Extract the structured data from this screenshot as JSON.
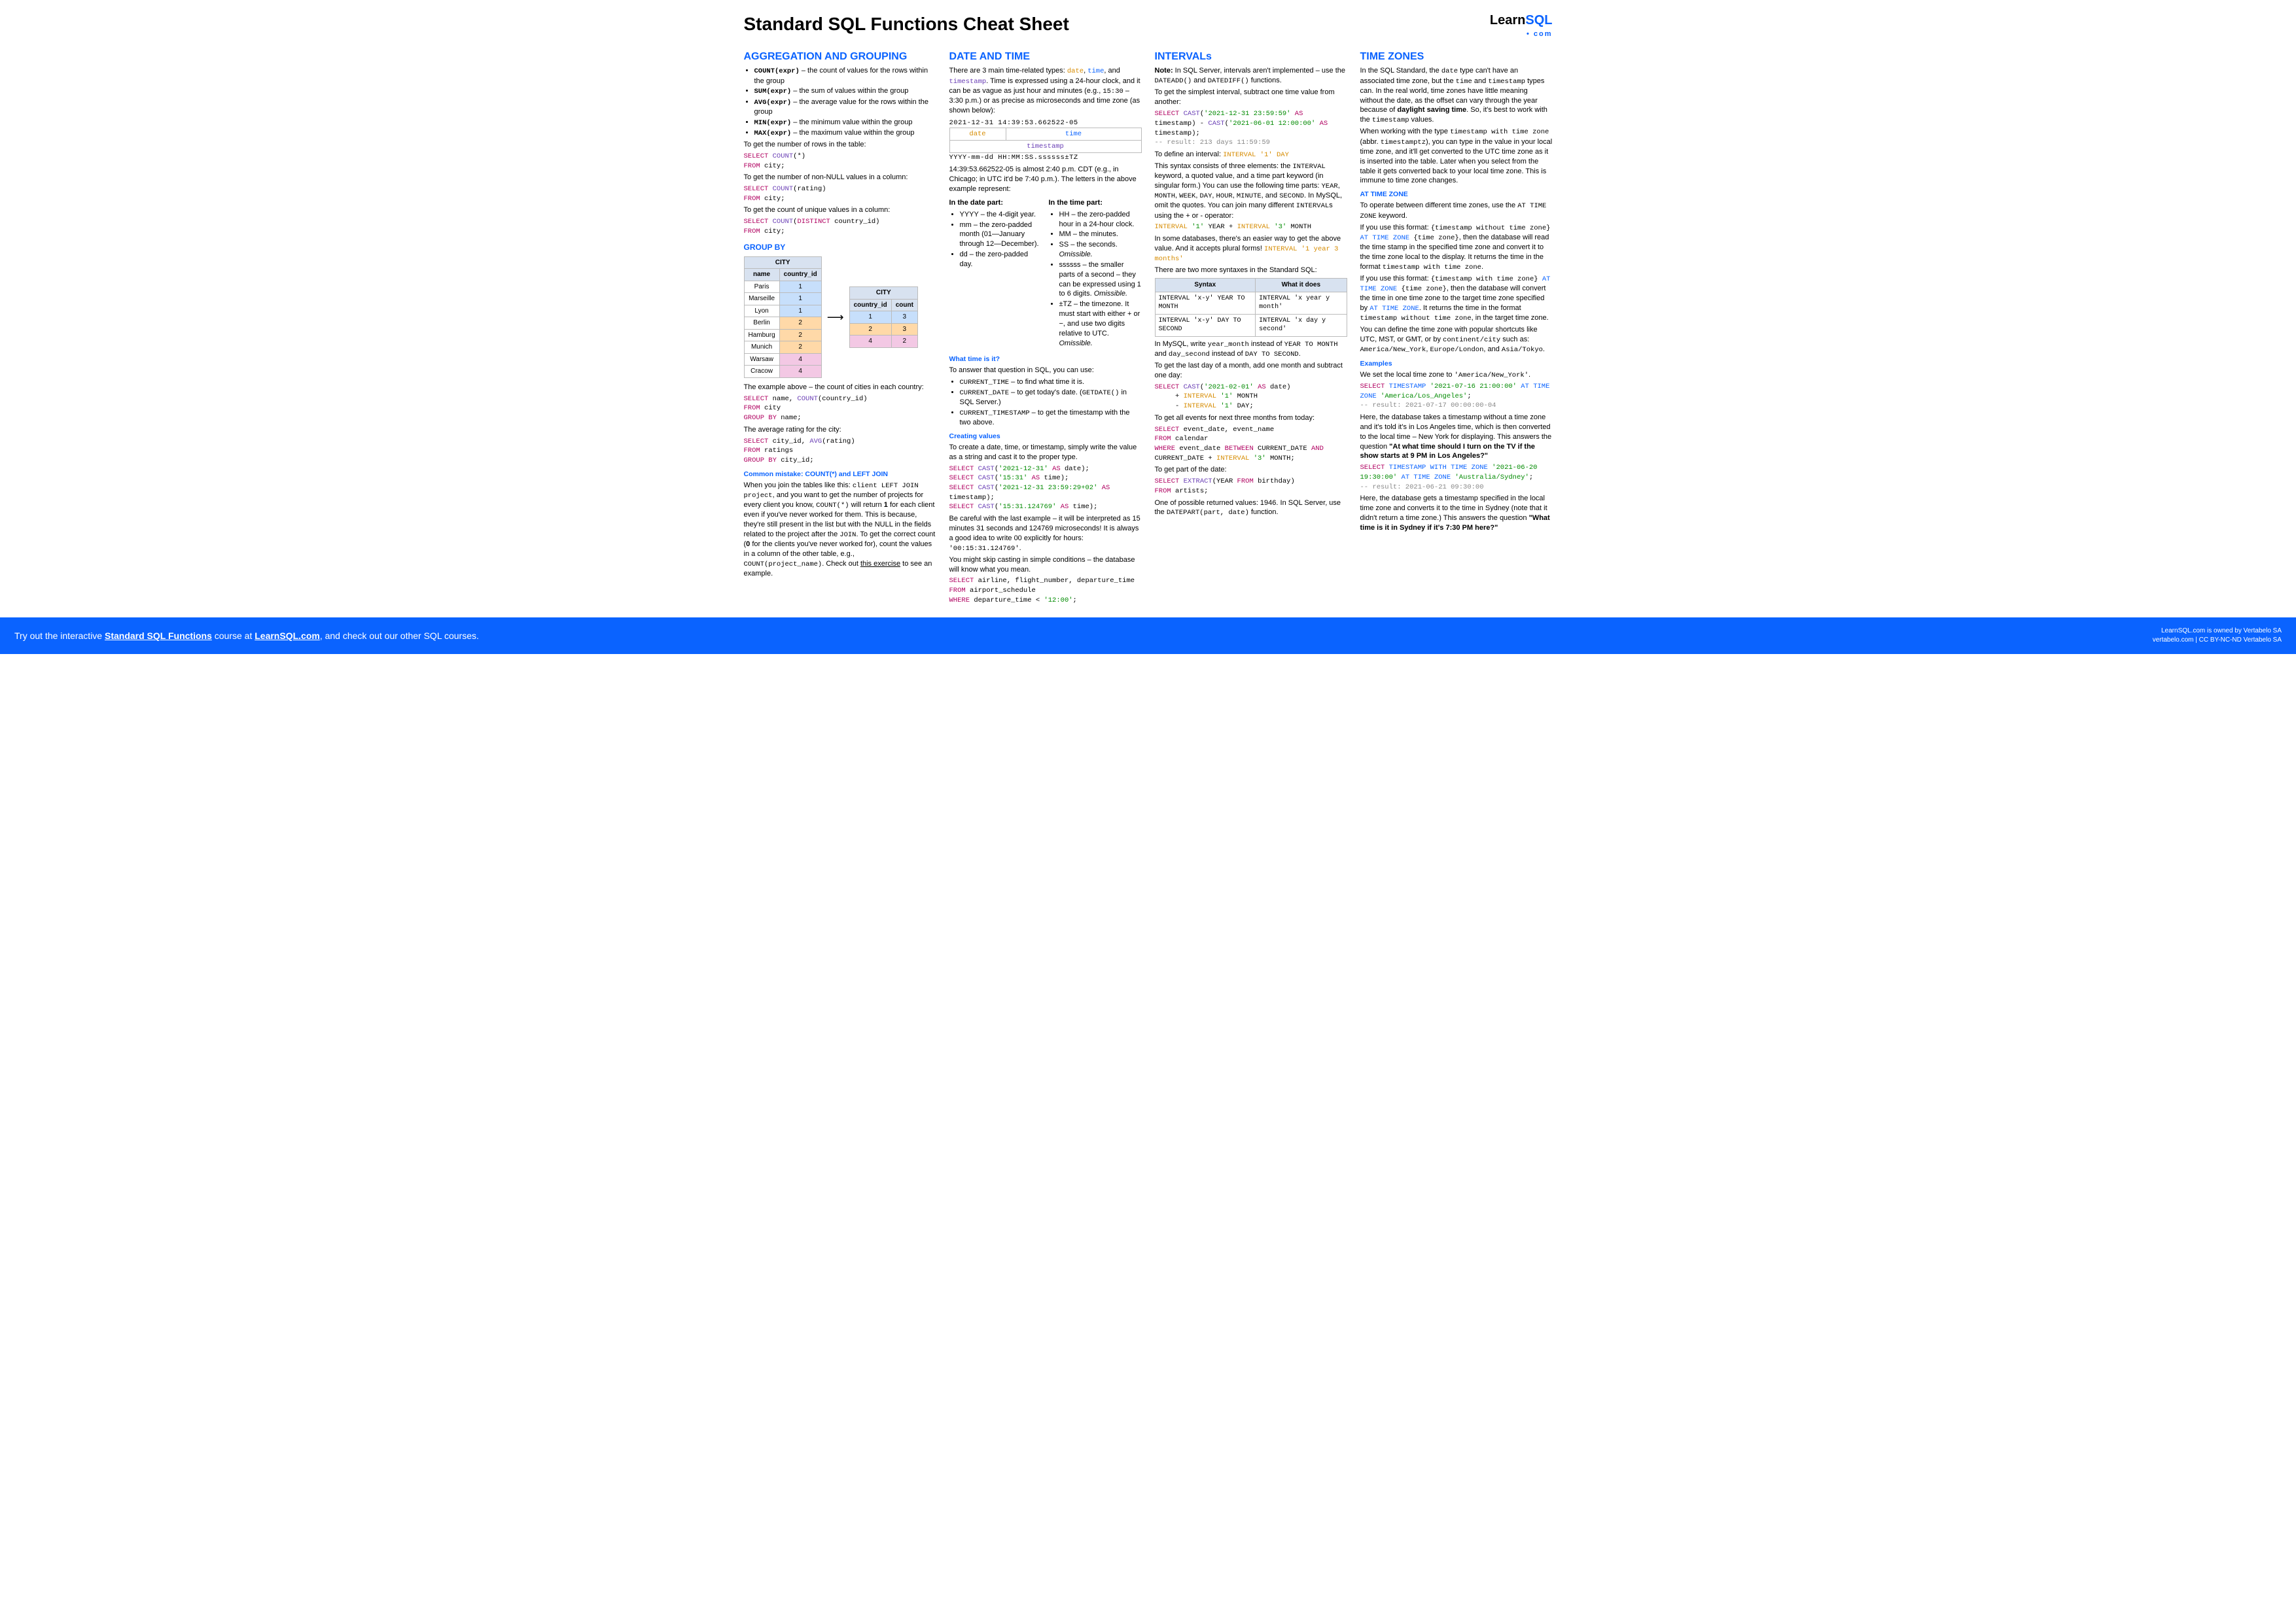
{
  "header": {
    "title": "Standard SQL Functions Cheat Sheet",
    "logo_learn": "Learn",
    "logo_sql": "SQL",
    "logo_com": "• com"
  },
  "col1": {
    "h_agg": "AGGREGATION AND GROUPING",
    "agg_items": [
      {
        "fn": "COUNT(expr)",
        "desc": " – the count of values for the rows within the group"
      },
      {
        "fn": "SUM(expr)",
        "desc": " – the sum of values within the group"
      },
      {
        "fn": "AVG(expr)",
        "desc": " – the average value for the rows within the group"
      },
      {
        "fn": "MIN(expr)",
        "desc": " – the minimum value within the group"
      },
      {
        "fn": "MAX(expr)",
        "desc": " – the maximum value within the group"
      }
    ],
    "p1": "To get the number of rows in the table:",
    "q1": "SELECT COUNT(*)\nFROM city;",
    "p2": "To get the number of non-NULL values in a column:",
    "q2": "SELECT COUNT(rating)\nFROM city;",
    "p3": "To get the count of unique values in a column:",
    "q3": "SELECT COUNT(DISTINCT country_id)\nFROM city;",
    "h_gb": "GROUP BY",
    "city_caption": "CITY",
    "city_cols": [
      "name",
      "country_id"
    ],
    "city_rows": [
      [
        "Paris",
        "1",
        "r-b"
      ],
      [
        "Marseille",
        "1",
        "r-b"
      ],
      [
        "Lyon",
        "1",
        "r-b"
      ],
      [
        "Berlin",
        "2",
        "r-o"
      ],
      [
        "Hamburg",
        "2",
        "r-o"
      ],
      [
        "Munich",
        "2",
        "r-o"
      ],
      [
        "Warsaw",
        "4",
        "r-p"
      ],
      [
        "Cracow",
        "4",
        "r-p"
      ]
    ],
    "city2_caption": "CITY",
    "city2_cols": [
      "country_id",
      "count"
    ],
    "city2_rows": [
      [
        "1",
        "3",
        "r-b"
      ],
      [
        "2",
        "3",
        "r-o"
      ],
      [
        "4",
        "2",
        "r-p"
      ]
    ],
    "gb_p1": "The example above – the count of cities in each country:",
    "gb_q1": "SELECT name, COUNT(country_id)\nFROM city\nGROUP BY name;",
    "gb_p2": "The average rating for the city:",
    "gb_q2": "SELECT city_id, AVG(rating)\nFROM ratings\nGROUP BY city_id;",
    "h_mistake": "Common mistake: COUNT(*) and LEFT JOIN",
    "mistake_text": "When you join the tables like this: client LEFT JOIN project, and you want to get the number of projects for every client you know, COUNT(*) will return 1 for each client even if you've never worked for them. This is because, they're still present in the list but with the NULL in the fields related to the project after the JOIN. To get the correct count (0 for the clients you've never worked for), count the values in a column of the other table, e.g., COUNT(project_name). Check out this exercise to see an example.",
    "mistake_link": "this exercise"
  },
  "col2": {
    "h": "DATE AND TIME",
    "intro": "There are 3 main time-related types: date, time, and timestamp. Time is expressed using a 24-hour clock, and it can be as vague as just hour and minutes (e.g., 15:30 – 3:30 p.m.) or as precise as microseconds and time zone (as shown below):",
    "ts_example": "2021-12-31 14:39:53.662522-05",
    "box_date": "date",
    "box_time": "time",
    "box_ts": "timestamp",
    "ts_format": "YYYY-mm-dd HH:MM:SS.ssssss±TZ",
    "p_explain": "14:39:53.662522-05 is almost 2:40 p.m. CDT (e.g., in Chicago; in UTC it'd be 7:40 p.m.). The letters in the above example represent:",
    "h_datepart": "In the date part:",
    "date_parts": [
      "YYYY – the 4-digit year.",
      "mm – the zero-padded month (01—January through 12—December).",
      "dd – the zero-padded day."
    ],
    "h_timepart": "In the time part:",
    "time_parts_1": "HH – the zero-padded hour in a 24-hour clock.",
    "time_parts_2": "MM – the minutes.",
    "time_parts_3a": "SS – the seconds. ",
    "time_parts_3b": "Omissible.",
    "time_parts_4a": "ssssss – the smaller parts of a second – they can be expressed using 1 to 6 digits. ",
    "time_parts_4b": "Omissible.",
    "time_parts_5a": "±TZ – the timezone. It must start with either + or −, and use two digits relative to UTC. ",
    "time_parts_5b": "Omissible.",
    "h_what": "What time is it?",
    "what_p": "To answer that question in SQL, you can use:",
    "what_items": [
      "CURRENT_TIME – to find what time it is.",
      "CURRENT_DATE – to get today's date. (GETDATE() in SQL Server.)",
      "CURRENT_TIMESTAMP – to get the timestamp with the two above."
    ],
    "h_create": "Creating values",
    "create_p": "To create a date, time, or timestamp, simply write the value as a string and cast it to the proper type.",
    "create_q": "SELECT CAST('2021-12-31' AS date);\nSELECT CAST('15:31' AS time);\nSELECT CAST('2021-12-31 23:59:29+02' AS timestamp);\nSELECT CAST('15:31.124769' AS time);",
    "create_warn": "Be careful with the last example – it will be interpreted as 15 minutes 31 seconds and 124769 microseconds! It is always a good idea to write 00 explicitly for hours: '00:15:31.124769'.",
    "skip_p": "You might skip casting in simple conditions – the database will know what you mean.",
    "skip_q": "SELECT airline, flight_number, departure_time\nFROM airport_schedule\nWHERE departure_time < '12:00';"
  },
  "col3": {
    "h": "INTERVALs",
    "note": "Note: In SQL Server, intervals aren't implemented – use the DATEADD() and DATEDIFF() functions.",
    "p1": "To get the simplest interval, subtract one time value from another:",
    "q1": "SELECT CAST('2021-12-31 23:59:59' AS timestamp) - CAST('2021-06-01 12:00:00' AS timestamp);\n-- result: 213 days 11:59:59",
    "p2a": "To define an interval:  ",
    "p2b": "INTERVAL '1' DAY",
    "p2c": "This syntax consists of three elements: the INTERVAL keyword, a quoted value, and a time part keyword (in singular form.) You can use the following time parts: YEAR, MONTH, WEEK, DAY, HOUR, MINUTE, and SECOND. In MySQL, omit the quotes. You can join many different INTERVALs using the + or - operator:",
    "q2": "INTERVAL '1' YEAR + INTERVAL '3' MONTH",
    "p3a": "In some databases, there's an easier way to get the above value. And it accepts plural forms!  ",
    "p3b": "INTERVAL '1 year 3 months'",
    "p4": "There are two more syntaxes in the Standard SQL:",
    "itbl_h1": "Syntax",
    "itbl_h2": "What it does",
    "itbl_r1c1": "INTERVAL 'x-y' YEAR TO MONTH",
    "itbl_r1c2": "INTERVAL 'x year y month'",
    "itbl_r2c1": "INTERVAL 'x-y' DAY TO SECOND",
    "itbl_r2c2": "INTERVAL 'x day y second'",
    "p5": "In MySQL, write year_month instead of YEAR TO MONTH and day_second instead of DAY TO SECOND.",
    "p6": "To get the last day of a month, add one month and subtract one day:",
    "q6": "SELECT CAST('2021-02-01' AS date)\n     + INTERVAL '1' MONTH\n     - INTERVAL '1' DAY;",
    "p7": "To get all events for next three months from today:",
    "q7": "SELECT event_date, event_name\nFROM calendar\nWHERE event_date BETWEEN CURRENT_DATE AND CURRENT_DATE + INTERVAL '3' MONTH;",
    "p8": "To get part of the date:",
    "q8": "SELECT EXTRACT(YEAR FROM birthday)\nFROM artists;",
    "p9": "One of possible returned values: 1946. In SQL Server, use the DATEPART(part, date) function."
  },
  "col4": {
    "h": "TIME ZONES",
    "p1": "In the SQL Standard, the date type can't have an associated time zone, but the time and timestamp types can. In the real world, time zones have little meaning without the date, as the offset can vary through the year because of daylight saving time. So, it's best to work with the timestamp values.",
    "p2": "When working with the type timestamp with time zone (abbr. timestamptz), you can type in the value in your local time zone, and it'll get converted to the UTC time zone as it is inserted into the table. Later when you select from the table it gets converted back to your local time zone. This is immune to time zone changes.",
    "h_atz": "AT TIME ZONE",
    "atz_p1": "To operate between different time zones, use the AT TIME ZONE keyword.",
    "atz_p2": "If you use this format: {timestamp without time zone} AT TIME ZONE {time zone}, then the database will read the time stamp in the specified time zone and convert it to the time zone local to the display. It returns the time in the format timestamp with time zone.",
    "atz_p3": "If you use this format: {timestamp with time zone} AT TIME ZONE {time zone}, then the database will convert the time in one time zone to the target time zone specified by AT TIME ZONE. It returns the time in the format timestamp without time zone, in the target time zone.",
    "atz_p4": "You can define the time zone with popular shortcuts like UTC, MST, or GMT, or by continent/city such as: America/New_York, Europe/London, and Asia/Tokyo.",
    "h_ex": "Examples",
    "ex_p1": "We set the local time zone to 'America/New_York'.",
    "ex_q1": "SELECT TIMESTAMP '2021-07-16 21:00:00' AT TIME ZONE 'America/Los_Angeles';\n-- result: 2021-07-17 00:00:00-04",
    "ex_p2": "Here, the database takes a timestamp without a time zone and it's told it's in Los Angeles time, which is then converted to the local time – New York for displaying. This answers the question \"At what time should I turn on the TV if the show starts at 9 PM in Los Angeles?\"",
    "ex_q2": "SELECT TIMESTAMP WITH TIME ZONE '2021-06-20 19:30:00' AT TIME ZONE 'Australia/Sydney';\n-- result: 2021-06-21 09:30:00",
    "ex_p3": "Here, the database gets a timestamp specified in the local time zone and converts it to the time in Sydney (note that it didn't return a time zone.) This answers the question \"What time is it in Sydney if it's 7:30 PM here?\""
  },
  "footer": {
    "cta_pre": "Try out the interactive ",
    "cta_link": "Standard SQL Functions",
    "cta_mid": " course at ",
    "cta_site": "LearnSQL.com",
    "cta_post": ", and check out our other SQL courses.",
    "r1": "LearnSQL.com is owned by Vertabelo SA",
    "r2": "vertabelo.com | CC BY-NC-ND Vertabelo SA"
  }
}
